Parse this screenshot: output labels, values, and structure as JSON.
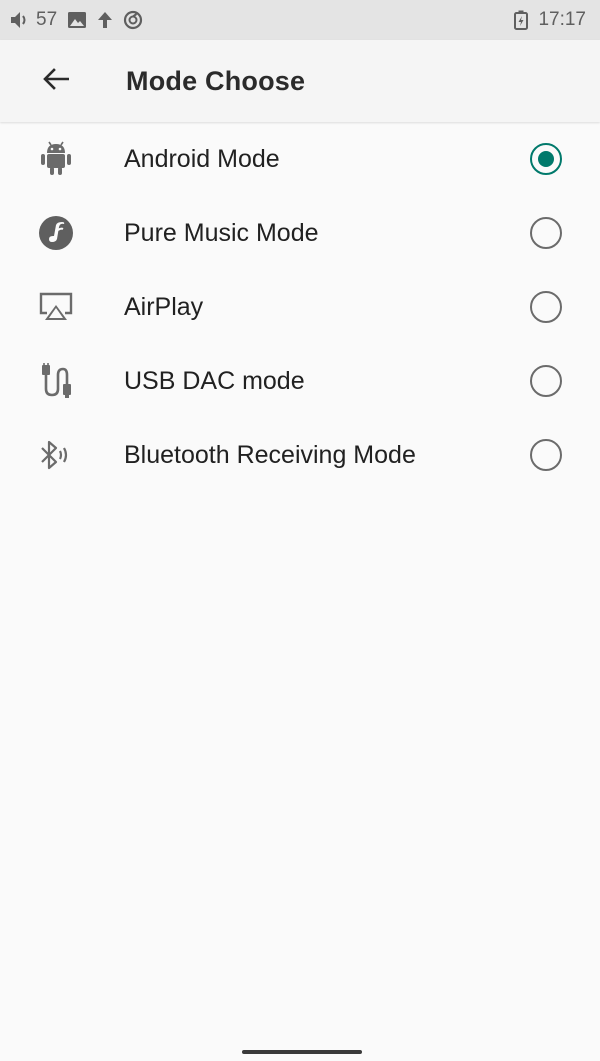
{
  "status_bar": {
    "volume_level": "57",
    "time": "17:17",
    "icons": [
      "volume-icon",
      "image-icon",
      "upload-arrow-icon",
      "sync-icon",
      "battery-charging-icon"
    ]
  },
  "app_bar": {
    "title": "Mode Choose",
    "back_icon": "arrow-back-icon"
  },
  "modes": [
    {
      "label": "Android Mode",
      "icon": "android-icon",
      "selected": true
    },
    {
      "label": "Pure Music Mode",
      "icon": "music-note-icon",
      "selected": false
    },
    {
      "label": "AirPlay",
      "icon": "airplay-icon",
      "selected": false
    },
    {
      "label": "USB DAC mode",
      "icon": "usb-cable-icon",
      "selected": false
    },
    {
      "label": "Bluetooth Receiving Mode",
      "icon": "bluetooth-audio-icon",
      "selected": false
    }
  ],
  "colors": {
    "accent": "#00796b",
    "status_bar_bg": "#e4e4e4",
    "app_bar_bg": "#f5f5f5",
    "background": "#fafafa"
  }
}
